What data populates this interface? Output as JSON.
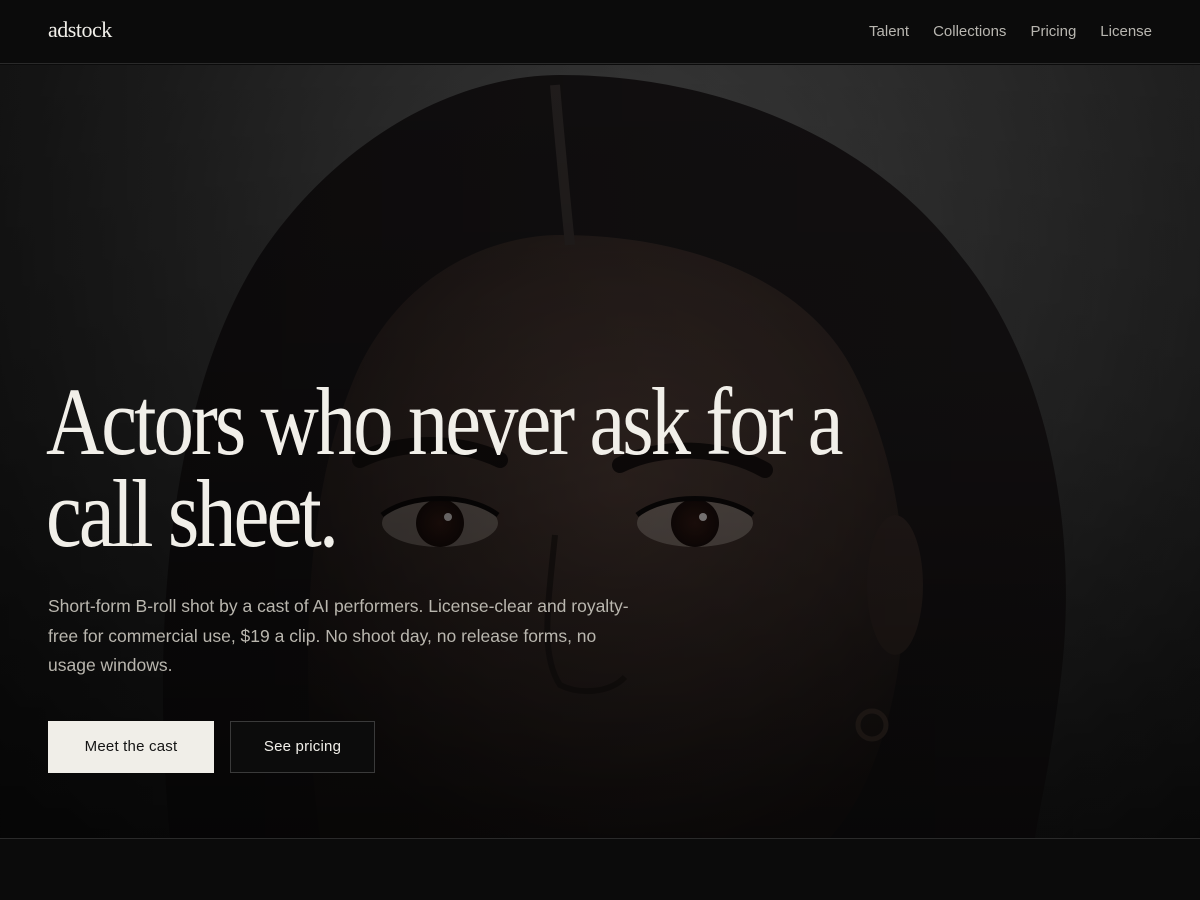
{
  "brand": {
    "logo": "adstock"
  },
  "nav": {
    "items": [
      "Talent",
      "Collections",
      "Pricing",
      "License"
    ]
  },
  "hero": {
    "headline": "Actors who never ask for a call sheet.",
    "subcopy": "Short-form B-roll shot by a cast of AI performers. License-clear and royalty-free for commercial use, $19 a clip. No shoot day, no release forms, no usage windows.",
    "primary_cta": "Meet the cast",
    "secondary_cta": "See pricing"
  },
  "colors": {
    "background": "#0b0b0b",
    "text_primary": "#f1efe9",
    "text_muted": "#b9b6ae",
    "button_light": "#f0eee8"
  }
}
